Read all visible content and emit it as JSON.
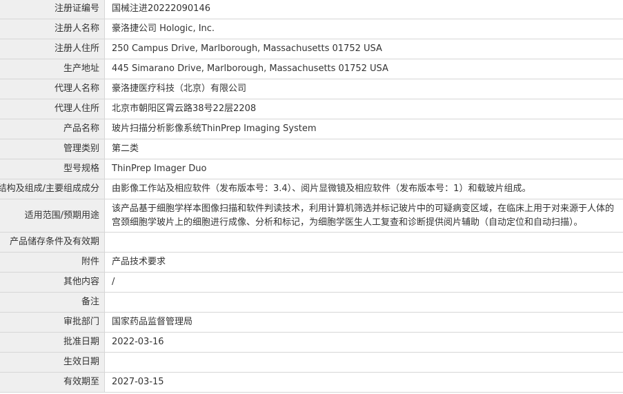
{
  "rows": [
    {
      "label": "注册证编号",
      "value": "国械注进20222090146"
    },
    {
      "label": "注册人名称",
      "value": "豪洛捷公司 Hologic, Inc."
    },
    {
      "label": "注册人住所",
      "value": "250 Campus Drive, Marlborough, Massachusetts 01752 USA"
    },
    {
      "label": "生产地址",
      "value": "445 Simarano Drive, Marlborough, Massachusetts 01752 USA"
    },
    {
      "label": "代理人名称",
      "value": "豪洛捷医疗科技（北京）有限公司"
    },
    {
      "label": "代理人住所",
      "value": "北京市朝阳区霄云路38号22层2208"
    },
    {
      "label": "产品名称",
      "value": "玻片扫描分析影像系统ThinPrep Imaging System"
    },
    {
      "label": "管理类别",
      "value": "第二类"
    },
    {
      "label": "型号规格",
      "value": "ThinPrep Imager Duo"
    },
    {
      "label": "结构及组成/主要组成成分",
      "value": "由影像工作站及相应软件（发布版本号：3.4）、阅片显微镜及相应软件（发布版本号：1）和载玻片组成。"
    },
    {
      "label": "适用范围/预期用途",
      "value": "该产品基于细胞学样本图像扫描和软件判读技术，利用计算机筛选并标记玻片中的可疑病变区域，在临床上用于对来源于人体的宫颈细胞学玻片上的细胞进行成像、分析和标记，为细胞学医生人工复查和诊断提供阅片辅助（自动定位和自动扫描）。"
    },
    {
      "label": "产品储存条件及有效期",
      "value": ""
    },
    {
      "label": "附件",
      "value": "产品技术要求"
    },
    {
      "label": "其他内容",
      "value": "/"
    },
    {
      "label": "备注",
      "value": ""
    },
    {
      "label": "审批部门",
      "value": "国家药品监督管理局"
    },
    {
      "label": "批准日期",
      "value": "2022-03-16"
    },
    {
      "label": "生效日期",
      "value": ""
    },
    {
      "label": "有效期至",
      "value": "2027-03-15"
    }
  ]
}
